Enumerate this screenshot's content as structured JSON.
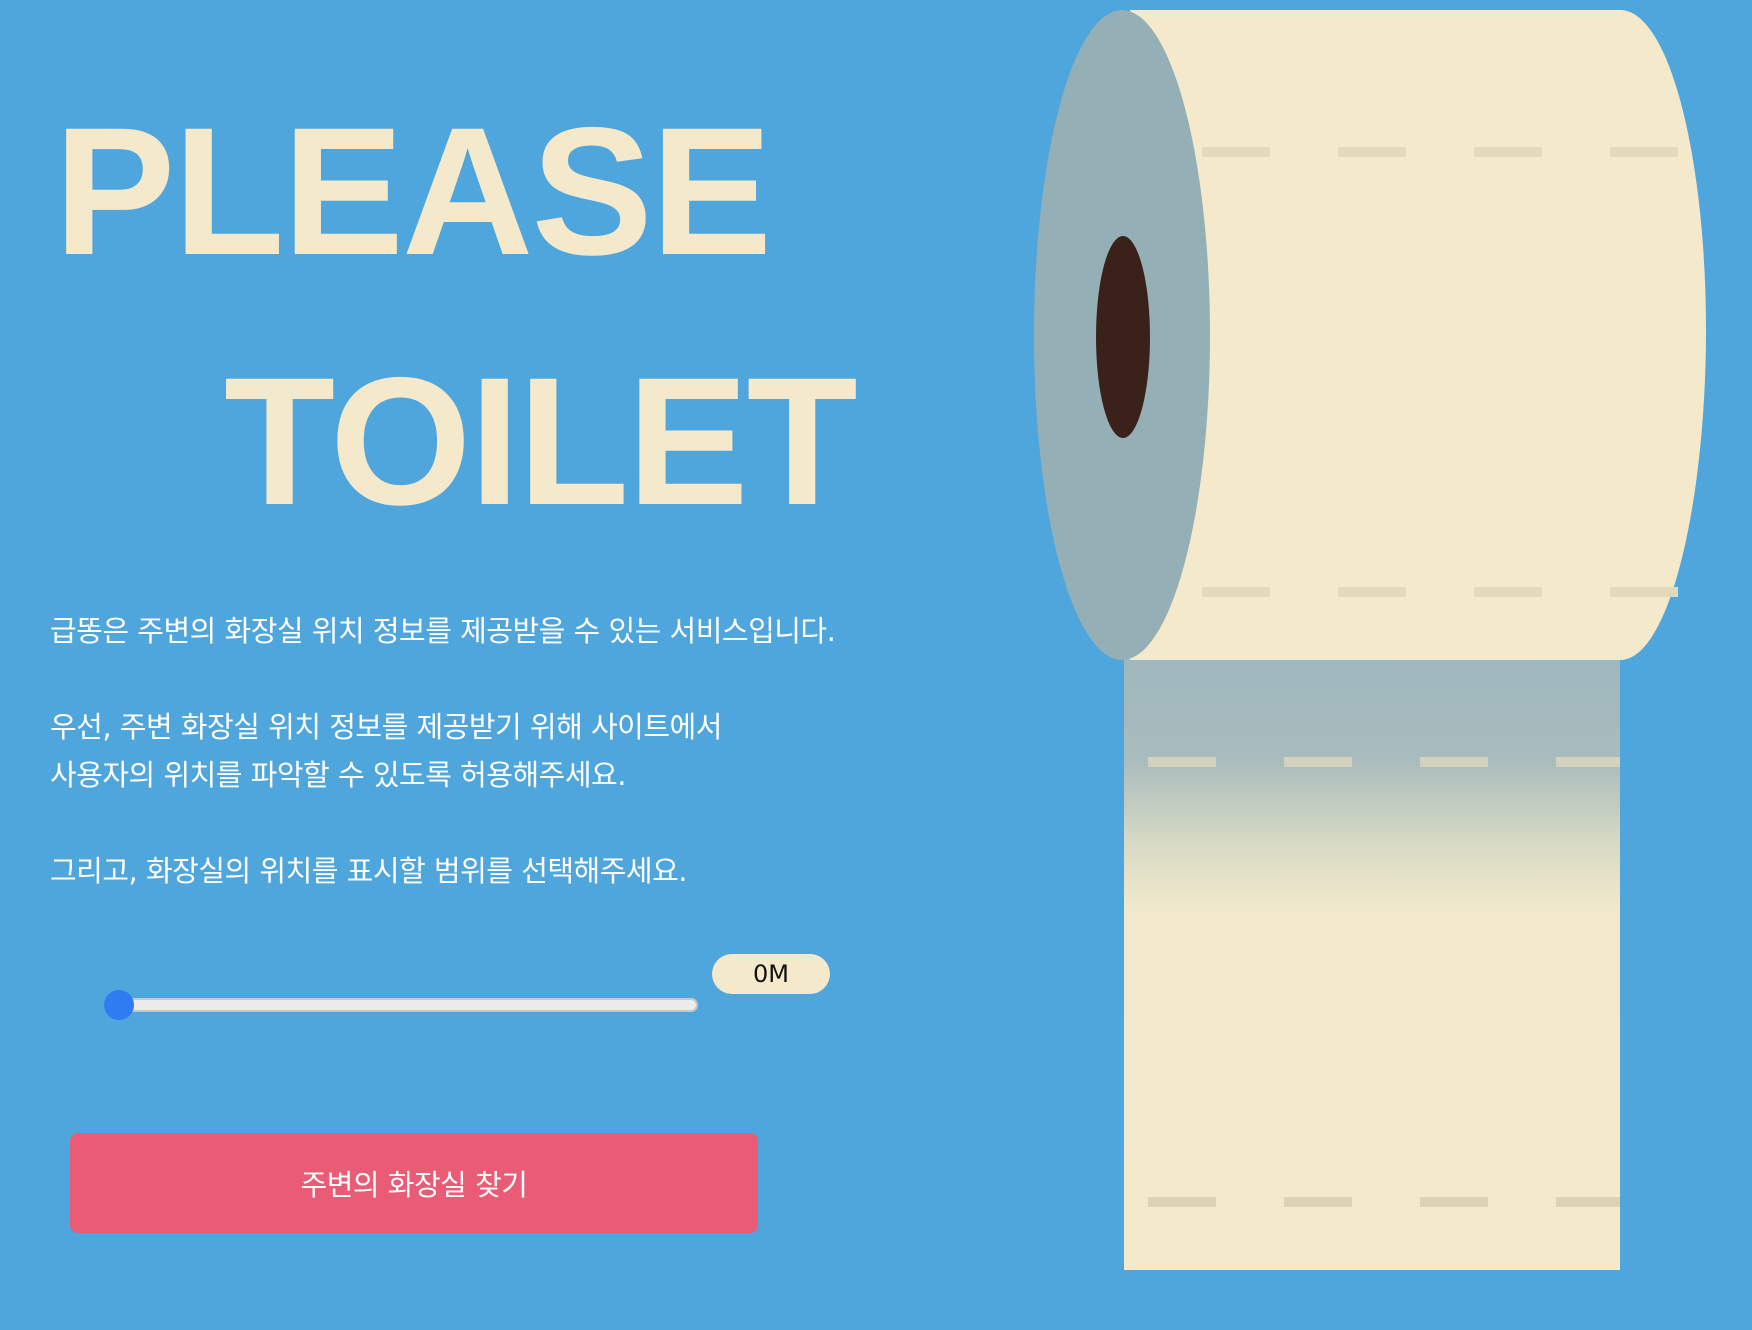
{
  "hero": {
    "title_line1": "PLEASE",
    "title_line2": "TOILET"
  },
  "description": {
    "line1": "급똥은 주변의 화장실 위치 정보를 제공받을 수 있는 서비스입니다.",
    "line2": "우선, 주변 화장실 위치 정보를 제공받기 위해 사이트에서",
    "line3": "사용자의 위치를 파악할 수 있도록 허용해주세요.",
    "line4": "그리고, 화장실의 위치를 표시할 범위를 선택해주세요."
  },
  "range": {
    "value": 0,
    "value_label": "0M"
  },
  "actions": {
    "find_label": "주변의 화장실 찾기"
  },
  "colors": {
    "background": "#4fa6dc",
    "title": "#f4e9cb",
    "button": "#ea5b75",
    "slider_thumb": "#2f7cf2",
    "badge": "#f4e9cb"
  },
  "icons": {
    "illustration": "toilet-paper-roll"
  }
}
